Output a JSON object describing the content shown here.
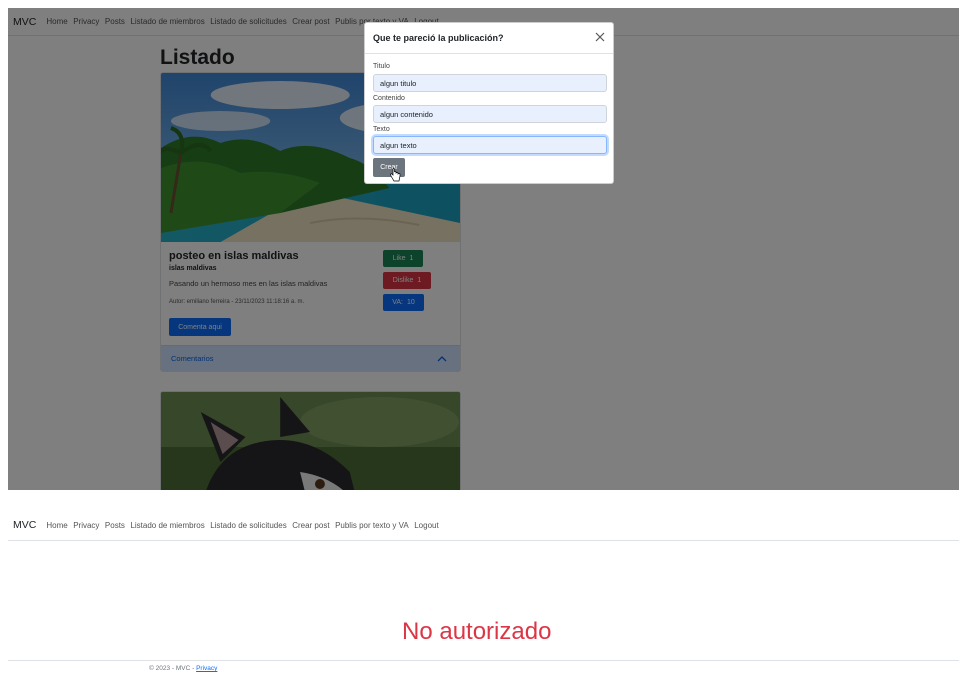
{
  "screen1": {
    "navbar": {
      "brand": "MVC",
      "links": [
        "Home",
        "Privacy",
        "Posts",
        "Listado de miembros",
        "Listado de solicitudes",
        "Crear post",
        "Publis por texto y VA",
        "Logout"
      ]
    },
    "page_title": "Listado",
    "post": {
      "title": "posteo en islas maldivas",
      "subtitle": "islas maldivas",
      "body": "Pasando un hermoso mes en las islas maldivas",
      "author": "Autor: emiliano ferreira - 23/11/2023 11:18:16 a. m.",
      "like_label": "Like",
      "like_count": "1",
      "dislike_label": "Dislike",
      "dislike_count": "1",
      "va_label": "VA:",
      "va_value": "10",
      "comment_button": "Comenta aqui",
      "comments_label": "Comentarios"
    },
    "modal": {
      "title": "Que te pareció la publicación?",
      "fields": [
        {
          "label": "Titulo",
          "value": "algun titulo"
        },
        {
          "label": "Contenido",
          "value": "algun contenido"
        },
        {
          "label": "Texto",
          "value": "algun texto"
        }
      ],
      "submit_label": "Crear"
    }
  },
  "screen2": {
    "navbar": {
      "brand": "MVC",
      "links": [
        "Home",
        "Privacy",
        "Posts",
        "Listado de miembros",
        "Listado de solicitudes",
        "Crear post",
        "Publis por texto y VA",
        "Logout"
      ]
    },
    "message": "No autorizado",
    "footer": {
      "copyright": "© 2023 - MVC - ",
      "privacy_link": "Privacy"
    }
  },
  "colors": {
    "primary": "#0d6efd",
    "success": "#198754",
    "danger": "#dc3545",
    "secondary": "#6c757d"
  }
}
